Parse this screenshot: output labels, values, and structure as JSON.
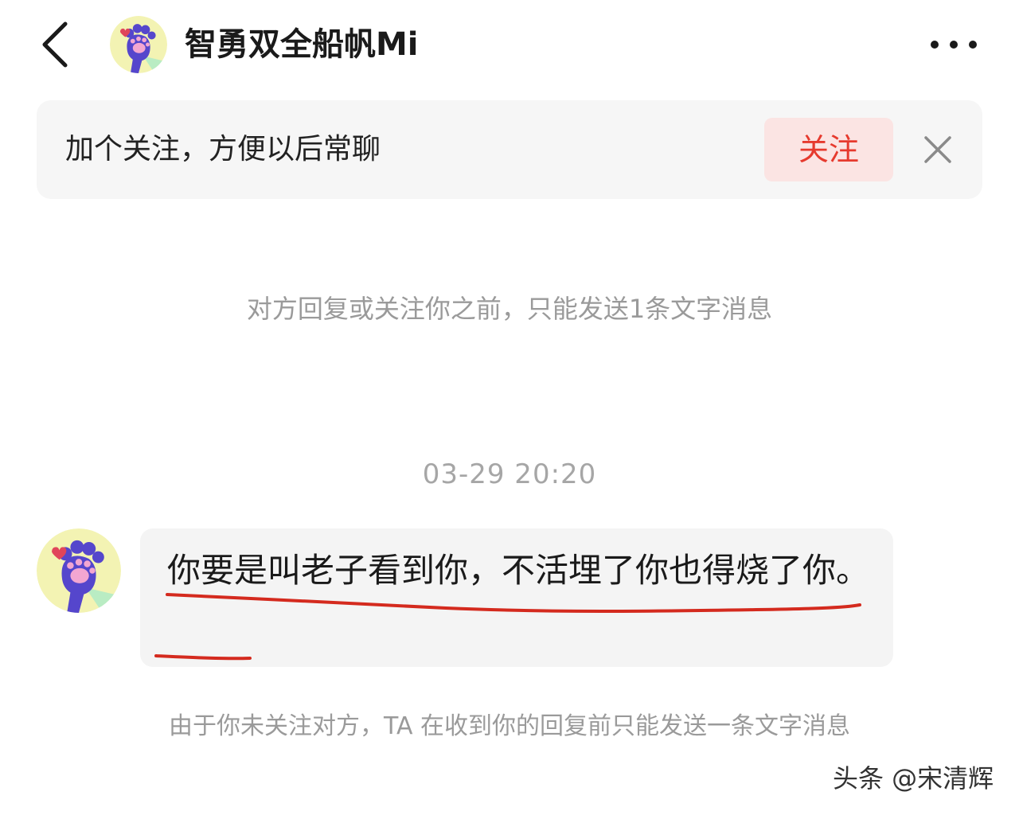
{
  "header": {
    "back_icon": "chevron-left-icon",
    "title": "智勇双全船帆Mi",
    "more_icon": "ellipsis-horizontal-icon"
  },
  "follow_banner": {
    "text": "加个关注，方便以后常聊",
    "button_label": "关注",
    "close_icon": "close-icon",
    "button_bg": "#fbe4e3",
    "button_color": "#e63a2e"
  },
  "notices": {
    "limit_notice": "对方回复或关注你之前，只能发送1条文字消息",
    "timestamp": "03-29 20:20",
    "bottom_notice": "由于你未关注对方，TA 在收到你的回复前只能发送一条文字消息"
  },
  "message": {
    "avatar_icon": "cat-paw-avatar-icon",
    "text": "你要是叫老子看到你，不活埋了你也得烧了你。",
    "annotation_color": "#d42a1e"
  },
  "watermark": {
    "text": "头条 @宋清辉"
  }
}
